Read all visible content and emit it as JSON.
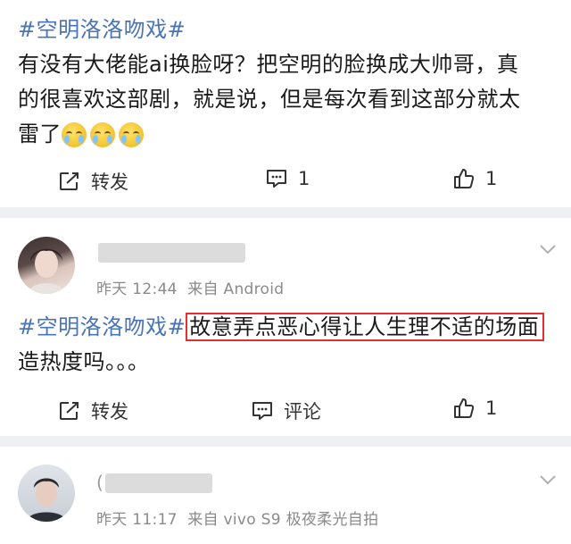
{
  "post1": {
    "topic": "#空明洛洛吻戏#",
    "line1": "有没有大佬能ai换脸呀？把空明的脸换成大帅哥，真",
    "line2": "的很喜欢这部剧，就是说，但是每次看到这部分就太",
    "line3": "雷了",
    "repost_label": "转发",
    "comment_count": "1",
    "like_count": "1"
  },
  "post2": {
    "time": "昨天 12:44",
    "source": "来自 Android",
    "topic": "#空明洛洛吻戏#",
    "highlight_text": "故意弄点恶心得让人生理不适的场面",
    "line2": "造热度吗。。。",
    "repost_label": "转发",
    "comment_label": "评论",
    "like_count": "1"
  },
  "post3": {
    "name_prefix": "(",
    "time": "昨天 11:17",
    "source": "来自 vivo S9 极夜柔光自拍"
  },
  "colors": {
    "topic": "#4a74b6",
    "separator": "#eef0f3",
    "highlight_border": "#e23030"
  }
}
